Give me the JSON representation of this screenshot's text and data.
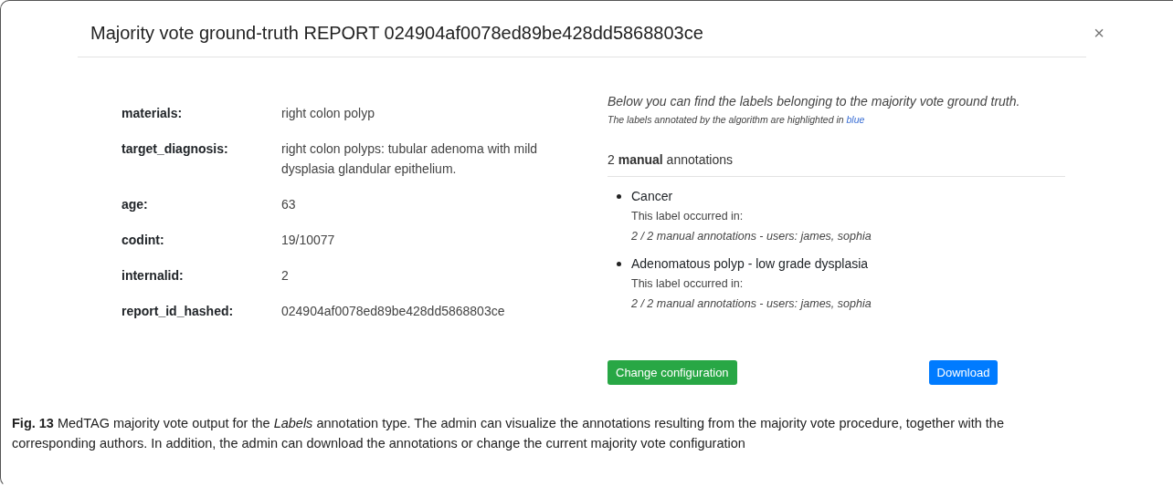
{
  "modal": {
    "title": "Majority vote ground-truth REPORT 024904af0078ed89be428dd5868803ce",
    "close": "×"
  },
  "fields": [
    {
      "label": "materials:",
      "value": "right colon polyp"
    },
    {
      "label": "target_diagnosis:",
      "value": "right colon polyps: tubular adenoma with mild dysplasia glandular epithelium."
    },
    {
      "label": "age:",
      "value": "63"
    },
    {
      "label": "codint:",
      "value": "19/10077"
    },
    {
      "label": "internalid:",
      "value": "2"
    },
    {
      "label": "report_id_hashed:",
      "value": "024904af0078ed89be428dd5868803ce"
    }
  ],
  "intro": "Below you can find the labels belonging to the majority vote ground truth.",
  "note": {
    "text": "The labels annotated by the algorithm are highlighted in",
    "link": "blue"
  },
  "annotations_heading": "2 **manual** annotations",
  "annotations": [
    {
      "label": "Cancer",
      "intro": "This label occurred in:",
      "detail": "2 / 2 manual annotations - users: james, sophia"
    },
    {
      "label": "Adenomatous polyp - low grade dysplasia",
      "intro": "This label occurred in:",
      "detail": "2 / 2 manual annotations - users: james, sophia"
    }
  ],
  "buttons": [
    "Change configuration",
    "Download"
  ],
  "caption": "**Fig. 13**  MedTAG majority vote output for the *Labels* annotation type. The admin can visualize the annotations resulting from the majority vote procedure, together with the corresponding authors. In addition, the admin can download the annotations or change the current majority vote configuration"
}
